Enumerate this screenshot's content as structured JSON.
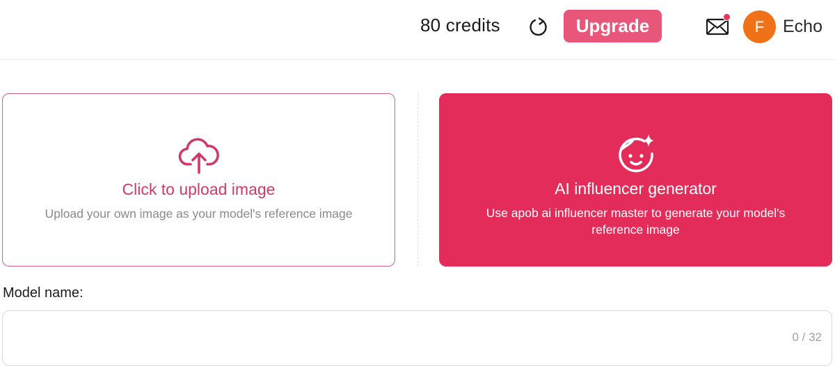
{
  "header": {
    "credits_text": "80 credits",
    "refresh_icon": "refresh-icon",
    "upgrade_label": "Upgrade",
    "mail_icon": "mail-icon",
    "has_notification": true,
    "avatar_initial": "F",
    "username": "Echo"
  },
  "cards": {
    "upload": {
      "icon": "cloud-upload-icon",
      "title": "Click to upload image",
      "description": "Upload your own image as your model's reference image"
    },
    "ai": {
      "icon": "face-sparkle-icon",
      "title": "AI influencer generator",
      "description": "Use apob ai influencer master to generate your model's reference image"
    }
  },
  "form": {
    "model_name_label": "Model name:",
    "model_name_value": "",
    "model_name_placeholder": "",
    "counter": "0 / 32"
  },
  "colors": {
    "accent": "#e42c5a",
    "upgrade": "#e8567a",
    "avatar": "#f07218",
    "upload_border": "#d25b8a"
  }
}
